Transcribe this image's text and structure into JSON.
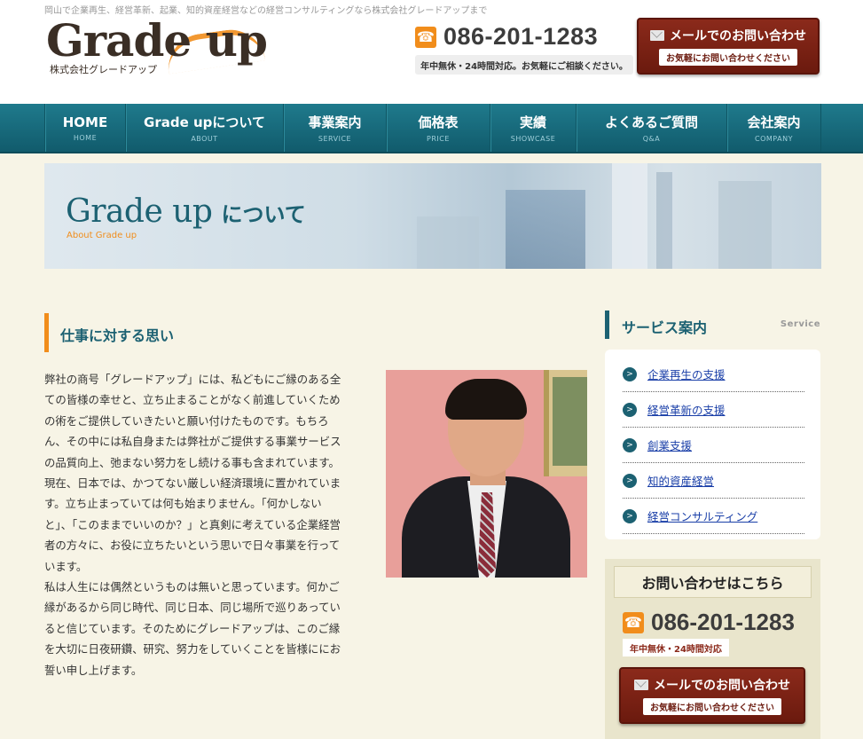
{
  "header": {
    "tagline": "岡山で企業再生、経営革新、起業、知的資産経営などの経営コンサルティングなら株式会社グレードアップまで",
    "logo_main": "Grade up",
    "logo_sub": "株式会社グレードアップ",
    "phone": "086-201-1283",
    "hours": "年中無休・24時間対応。お気軽にご相談ください。",
    "mail_button": "メールでのお問い合わせ",
    "mail_button_sub": "お気軽にお問い合わせください"
  },
  "nav": {
    "items": [
      {
        "label": "HOME",
        "sub": "HOME"
      },
      {
        "label": "Grade upについて",
        "sub": "ABOUT"
      },
      {
        "label": "事業案内",
        "sub": "SERVICE"
      },
      {
        "label": "価格表",
        "sub": "PRICE"
      },
      {
        "label": "実績",
        "sub": "SHOWCASE"
      },
      {
        "label": "よくあるご質問",
        "sub": "Q&A"
      },
      {
        "label": "会社案内",
        "sub": "COMPANY"
      }
    ]
  },
  "hero": {
    "title_a": "Grade up",
    "title_b": "について",
    "subtitle": "About Grade up"
  },
  "main": {
    "section_title": "仕事に対する思い",
    "paragraphs": [
      "弊社の商号「グレードアップ」には、私どもにご縁のある全ての皆様の幸せと、立ち止まることがなく前進していくための術をご提供していきたいと願い付けたものです。もちろん、その中には私自身または弊社がご提供する事業サービスの品質向上、弛まない努力をし続ける事も含まれています。",
      "現在、日本では、かつてない厳しい経済環境に置かれています。立ち止まっていては何も始まりません。「何かしないと」、「このままでいいのか？」と真剣に考えている企業経営者の方々に、お役に立ちたいという思いで日々事業を行っています。",
      "私は人生には偶然というものは無いと思っています。何かご縁があるから同じ時代、同じ日本、同じ場所で巡りあっていると信じています。そのためにグレードアップは、このご縁を大切に日夜研鑽、研究、努力をしていくことを皆様ににお誓い申し上げます。"
    ]
  },
  "sidebar": {
    "service_title": "サービス案内",
    "service_title_en": "Service",
    "services": [
      "企業再生の支援",
      "経営革新の支援",
      "創業支援",
      "知的資産経営",
      "経営コンサルティング"
    ],
    "contact_title": "お問い合わせはこちら",
    "contact_phone": "086-201-1283",
    "contact_hours": "年中無休・24時間対応",
    "mail_button": "メールでのお問い合わせ",
    "mail_button_sub": "お気軽にお問い合わせください"
  },
  "colors": {
    "nav_bg": "#1a6f80",
    "accent_orange": "#f18d1b",
    "teal_text": "#1c6172",
    "button_red": "#7a2214",
    "page_bg": "#f7f4e6"
  },
  "icons": {
    "phone": "phone-icon",
    "mail": "envelope-icon",
    "service_bullet": "arrow-circle-icon"
  }
}
